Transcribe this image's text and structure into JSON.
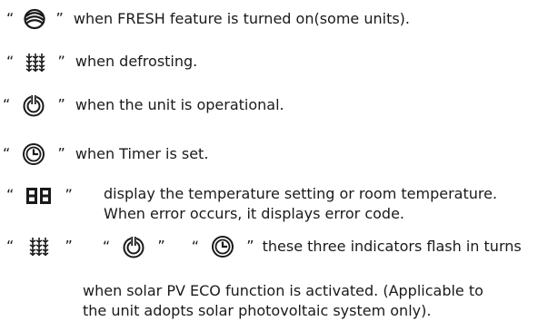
{
  "quote_open": "“",
  "quote_close": "”",
  "rows": {
    "fresh": {
      "icon": "fresh-swirl-icon",
      "text": "when FRESH feature is turned on(some units)."
    },
    "defrost": {
      "icon": "defrost-icon",
      "text": "when defrosting."
    },
    "operation": {
      "icon": "power-icon",
      "text": "when the unit is operational."
    },
    "timer": {
      "icon": "timer-clock-icon",
      "text": "when Timer is set."
    },
    "display": {
      "icon": "seven-segment-88-icon",
      "line1": "display the temperature setting or room temperature.",
      "line2": "When error occurs, it displays error code."
    },
    "solar": {
      "icons": [
        "defrost-icon",
        "power-icon",
        "timer-clock-icon"
      ],
      "line1": "these three indicators flash in turns",
      "line2": "when solar PV ECO function is activated. (Applicable to",
      "line3": "the unit adopts solar photovoltaic system only)."
    }
  }
}
